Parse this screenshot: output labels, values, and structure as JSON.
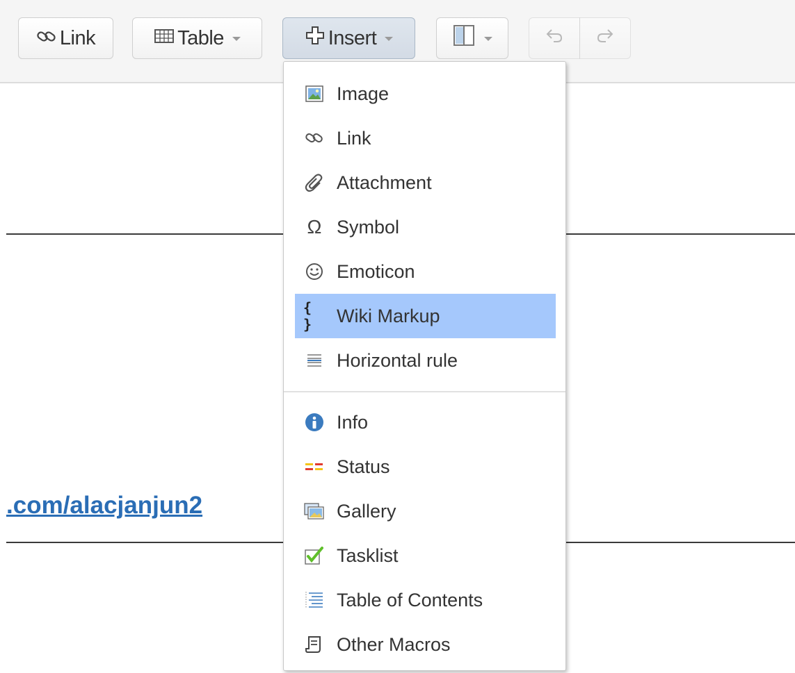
{
  "toolbar": {
    "link_label": "Link",
    "table_label": "Table",
    "insert_label": "Insert"
  },
  "content": {
    "link_text": ".com/alacjanjun2"
  },
  "insert_menu": {
    "items": [
      {
        "label": "Image",
        "icon": "image-icon"
      },
      {
        "label": "Link",
        "icon": "link-icon"
      },
      {
        "label": "Attachment",
        "icon": "paperclip-icon"
      },
      {
        "label": "Symbol",
        "icon": "omega-icon"
      },
      {
        "label": "Emoticon",
        "icon": "smiley-icon"
      },
      {
        "label": "Wiki Markup",
        "icon": "braces-icon",
        "highlighted": true
      },
      {
        "label": "Horizontal rule",
        "icon": "horizontal-rule-icon"
      },
      {
        "label": "Info",
        "icon": "info-icon"
      },
      {
        "label": "Status",
        "icon": "status-icon"
      },
      {
        "label": "Gallery",
        "icon": "gallery-icon"
      },
      {
        "label": "Tasklist",
        "icon": "tasklist-icon"
      },
      {
        "label": "Table of Contents",
        "icon": "toc-icon"
      },
      {
        "label": "Other Macros",
        "icon": "macro-icon"
      }
    ]
  },
  "colors": {
    "highlight": "#a5c8fc",
    "link": "#2a6db5",
    "info": "#3b7bbf"
  }
}
